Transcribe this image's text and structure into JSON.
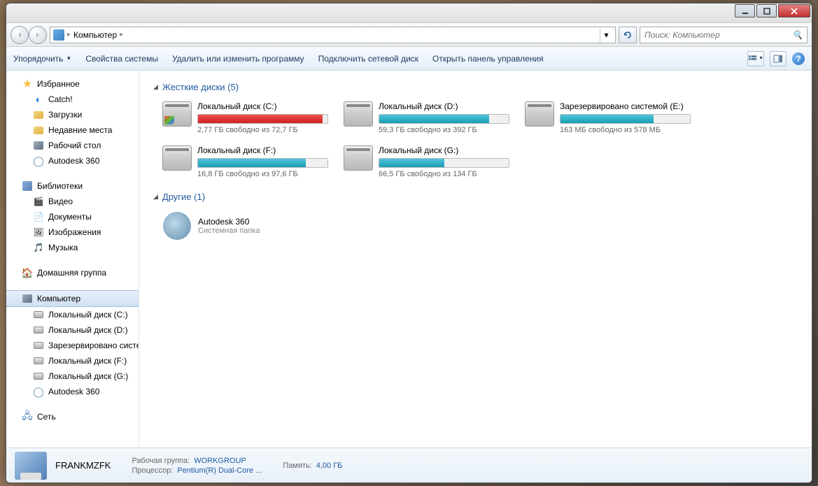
{
  "address": {
    "location": "Компьютер",
    "separator": "▸"
  },
  "search": {
    "placeholder": "Поиск: Компьютер"
  },
  "toolbar": {
    "organize": "Упорядочить",
    "properties": "Свойства системы",
    "uninstall": "Удалить или изменить программу",
    "mapdrive": "Подключить сетевой диск",
    "controlpanel": "Открыть панель управления"
  },
  "sidebar": {
    "favorites": {
      "label": "Избранное",
      "items": [
        {
          "label": "Catch!"
        },
        {
          "label": "Загрузки"
        },
        {
          "label": "Недавние места"
        },
        {
          "label": "Рабочий стол"
        },
        {
          "label": "Autodesk 360"
        }
      ]
    },
    "libraries": {
      "label": "Библиотеки",
      "items": [
        {
          "label": "Видео"
        },
        {
          "label": "Документы"
        },
        {
          "label": "Изображения"
        },
        {
          "label": "Музыка"
        }
      ]
    },
    "homegroup": {
      "label": "Домашняя группа"
    },
    "computer": {
      "label": "Компьютер",
      "items": [
        {
          "label": "Локальный диск (C:)"
        },
        {
          "label": "Локальный диск (D:)"
        },
        {
          "label": "Зарезервировано системой (E:)"
        },
        {
          "label": "Локальный диск (F:)"
        },
        {
          "label": "Локальный диск (G:)"
        },
        {
          "label": "Autodesk 360"
        }
      ]
    },
    "network": {
      "label": "Сеть"
    }
  },
  "content": {
    "drives_header": "Жесткие диски (5)",
    "other_header": "Другие (1)",
    "drives": [
      {
        "name": "Локальный диск (C:)",
        "status": "2,77 ГБ свободно из 72,7 ГБ",
        "fill": 96,
        "color": "red",
        "win": true
      },
      {
        "name": "Локальный диск (D:)",
        "status": "59,3 ГБ свободно из 392 ГБ",
        "fill": 85,
        "color": "teal"
      },
      {
        "name": "Зарезервировано системой (E:)",
        "status": "163 МБ свободно из 578 МБ",
        "fill": 72,
        "color": "teal"
      },
      {
        "name": "Локальный диск (F:)",
        "status": "16,8 ГБ свободно из 97,6 ГБ",
        "fill": 83,
        "color": "teal"
      },
      {
        "name": "Локальный диск (G:)",
        "status": "66,5 ГБ свободно из 134 ГБ",
        "fill": 50,
        "color": "teal"
      }
    ],
    "other": {
      "name": "Autodesk 360",
      "sub": "Системная папка"
    }
  },
  "details": {
    "name": "FRANKMZFK",
    "workgroup_label": "Рабочая группа:",
    "workgroup_value": "WORKGROUP",
    "memory_label": "Память:",
    "memory_value": "4,00 ГБ",
    "cpu_label": "Процессор:",
    "cpu_value": "Pentium(R) Dual-Core  ..."
  }
}
